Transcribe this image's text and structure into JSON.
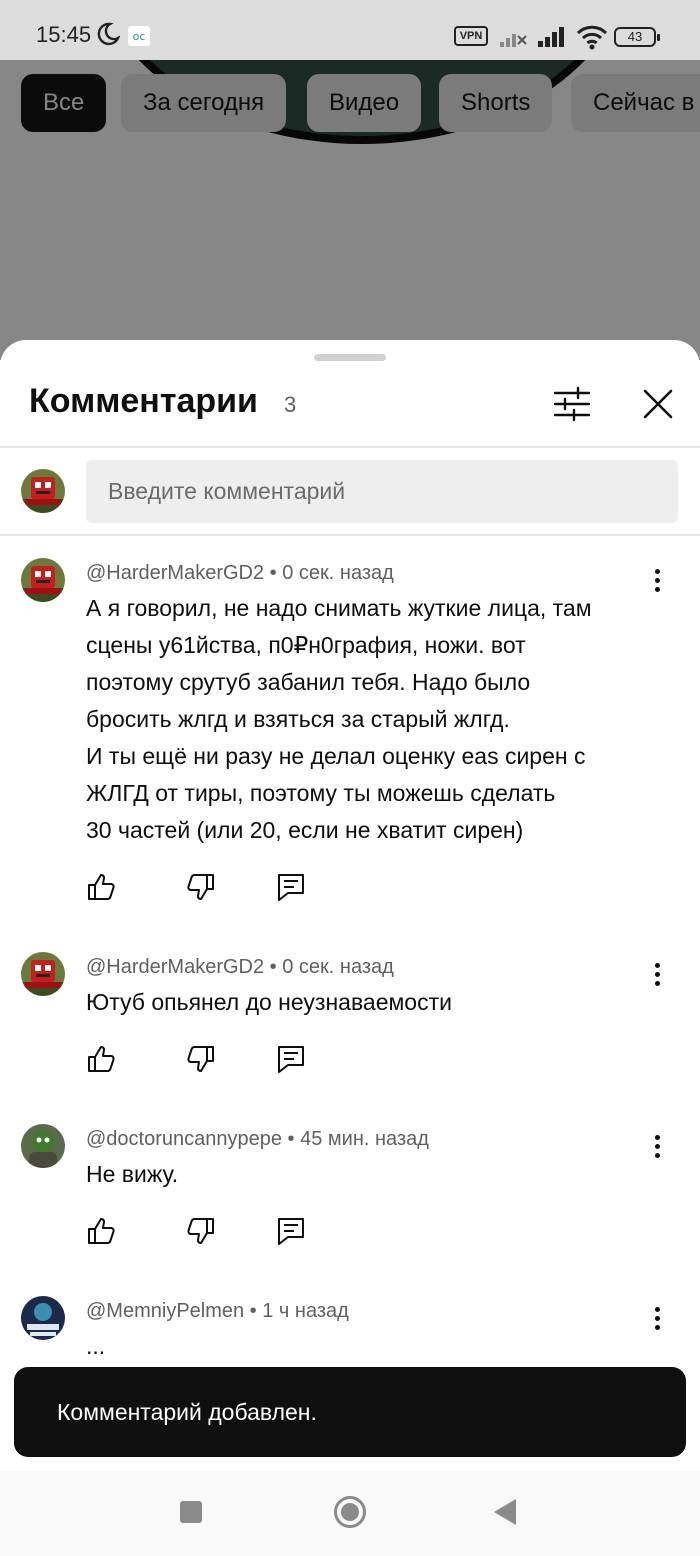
{
  "status_bar": {
    "time": "15:45",
    "vpn": "VPN",
    "battery": "43"
  },
  "chips": [
    {
      "label": "Все",
      "active": true
    },
    {
      "label": "За сегодня",
      "active": false
    },
    {
      "label": "Видео",
      "active": false
    },
    {
      "label": "Shorts",
      "active": false
    },
    {
      "label": "Сейчас в",
      "active": false
    }
  ],
  "comments_sheet": {
    "title": "Комментарии",
    "count": "3",
    "input_placeholder": "Введите комментарий",
    "comments": [
      {
        "author": "@HarderMakerGD2",
        "time": "0 сек. назад",
        "text": "А я говорил, не надо снимать жуткие лица, там\nсцены у61йства, п0₽н0графия, ножи. вот\nпоэтому срутуб забанил тебя. Надо было\nбросить жлгд и взяться за старый жлгд.\nИ ты ещё ни разу не делал оценку eas сирен с\nЖЛГД от тиры, поэтому ты можешь сделать\n30 частей (или 20, если не хватит сирен)"
      },
      {
        "author": "@HarderMakerGD2",
        "time": "0 сек. назад",
        "text": "Ютуб опьянел до неузнаваемости"
      },
      {
        "author": "@doctoruncannypepe",
        "time": "45 мин. назад",
        "text": "Не вижу."
      },
      {
        "author": "@MemniyPelmen",
        "time": "1 ч назад",
        "text": "..."
      }
    ]
  },
  "snackbar": {
    "message": "Комментарий добавлен."
  },
  "colors": {
    "text_primary": "#0f0f0f",
    "text_secondary": "#606060",
    "scrim": "#878787",
    "snackbar_bg": "#0f0f0f"
  },
  "icons": {
    "like": "thumb-up-icon",
    "dislike": "thumb-down-icon",
    "reply": "reply-icon",
    "more": "more-vert-icon",
    "filter": "sliders-icon",
    "close": "close-icon"
  }
}
